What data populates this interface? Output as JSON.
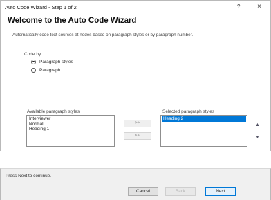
{
  "window": {
    "title": "Auto Code Wizard - Step 1 of 2",
    "help_glyph": "?",
    "close_glyph": "×"
  },
  "wizard": {
    "heading": "Welcome to the Auto Code Wizard",
    "description": "Automatically code text sources at nodes based on paragraph styles or by paragraph number."
  },
  "code_by": {
    "label": "Code by",
    "options": [
      {
        "label": "Paragraph styles",
        "selected": true
      },
      {
        "label": "Paragraph",
        "selected": false
      }
    ]
  },
  "available": {
    "label": "Available paragraph styles",
    "items": [
      "Interviewer",
      "Normal",
      "Heading 1"
    ]
  },
  "selected": {
    "label": "Selected paragraph styles",
    "items": [
      "Heading 2"
    ]
  },
  "move_buttons": {
    "add_label": ">>",
    "remove_label": "<<"
  },
  "order_buttons": {
    "up_glyph": "▲",
    "down_glyph": "▼"
  },
  "footer": {
    "status": "Press Next to continue.",
    "cancel_label": "Cancel",
    "back_label": "Back",
    "next_label": "Next"
  }
}
